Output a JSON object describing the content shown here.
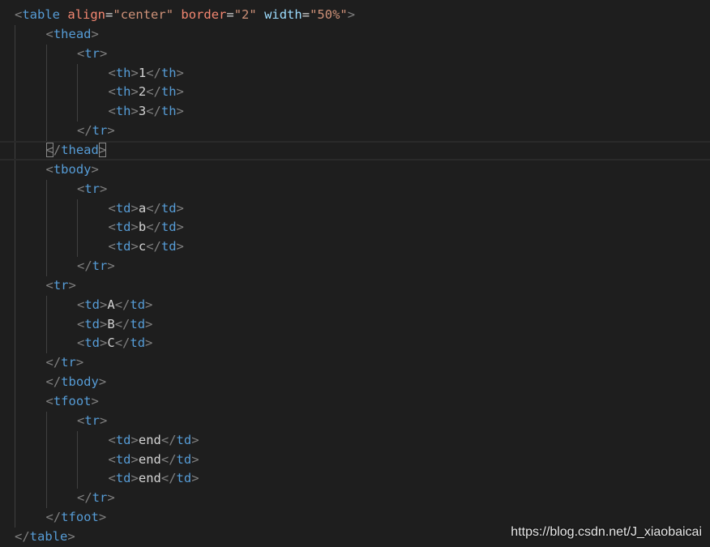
{
  "editor": {
    "lines": [
      {
        "indent": 0,
        "tokens": [
          [
            "b",
            "<"
          ],
          [
            "t",
            "table"
          ],
          [
            "x",
            " "
          ],
          [
            "ar",
            "align"
          ],
          [
            "e",
            "="
          ],
          [
            "s",
            "\"center\""
          ],
          [
            "x",
            " "
          ],
          [
            "ar",
            "border"
          ],
          [
            "e",
            "="
          ],
          [
            "s",
            "\"2\""
          ],
          [
            "x",
            " "
          ],
          [
            "a",
            "width"
          ],
          [
            "e",
            "="
          ],
          [
            "s",
            "\"50%\""
          ],
          [
            "b",
            ">"
          ]
        ]
      },
      {
        "indent": 1,
        "tokens": [
          [
            "b",
            "<"
          ],
          [
            "t",
            "thead"
          ],
          [
            "b",
            ">"
          ]
        ]
      },
      {
        "indent": 2,
        "tokens": [
          [
            "b",
            "<"
          ],
          [
            "t",
            "tr"
          ],
          [
            "b",
            ">"
          ]
        ]
      },
      {
        "indent": 3,
        "tokens": [
          [
            "b",
            "<"
          ],
          [
            "t",
            "th"
          ],
          [
            "b",
            ">"
          ],
          [
            "x",
            "1"
          ],
          [
            "b",
            "</"
          ],
          [
            "t",
            "th"
          ],
          [
            "b",
            ">"
          ]
        ]
      },
      {
        "indent": 3,
        "tokens": [
          [
            "b",
            "<"
          ],
          [
            "t",
            "th"
          ],
          [
            "b",
            ">"
          ],
          [
            "x",
            "2"
          ],
          [
            "b",
            "</"
          ],
          [
            "t",
            "th"
          ],
          [
            "b",
            ">"
          ]
        ]
      },
      {
        "indent": 3,
        "tokens": [
          [
            "b",
            "<"
          ],
          [
            "t",
            "th"
          ],
          [
            "b",
            ">"
          ],
          [
            "x",
            "3"
          ],
          [
            "b",
            "</"
          ],
          [
            "t",
            "th"
          ],
          [
            "b",
            ">"
          ]
        ]
      },
      {
        "indent": 2,
        "tokens": [
          [
            "b",
            "</"
          ],
          [
            "t",
            "tr"
          ],
          [
            "b",
            ">"
          ]
        ]
      },
      {
        "indent": 1,
        "current": true,
        "tokens": [
          [
            "bm",
            "<"
          ],
          [
            "b",
            "/"
          ],
          [
            "t",
            "thead"
          ],
          [
            "bm",
            ">"
          ]
        ]
      },
      {
        "indent": 1,
        "tokens": [
          [
            "b",
            "<"
          ],
          [
            "t",
            "tbody"
          ],
          [
            "b",
            ">"
          ]
        ]
      },
      {
        "indent": 2,
        "tokens": [
          [
            "b",
            "<"
          ],
          [
            "t",
            "tr"
          ],
          [
            "b",
            ">"
          ]
        ]
      },
      {
        "indent": 3,
        "tokens": [
          [
            "b",
            "<"
          ],
          [
            "t",
            "td"
          ],
          [
            "b",
            ">"
          ],
          [
            "x",
            "a"
          ],
          [
            "b",
            "</"
          ],
          [
            "t",
            "td"
          ],
          [
            "b",
            ">"
          ]
        ]
      },
      {
        "indent": 3,
        "tokens": [
          [
            "b",
            "<"
          ],
          [
            "t",
            "td"
          ],
          [
            "b",
            ">"
          ],
          [
            "x",
            "b"
          ],
          [
            "b",
            "</"
          ],
          [
            "t",
            "td"
          ],
          [
            "b",
            ">"
          ]
        ]
      },
      {
        "indent": 3,
        "tokens": [
          [
            "b",
            "<"
          ],
          [
            "t",
            "td"
          ],
          [
            "b",
            ">"
          ],
          [
            "x",
            "c"
          ],
          [
            "b",
            "</"
          ],
          [
            "t",
            "td"
          ],
          [
            "b",
            ">"
          ]
        ]
      },
      {
        "indent": 2,
        "tokens": [
          [
            "b",
            "</"
          ],
          [
            "t",
            "tr"
          ],
          [
            "b",
            ">"
          ]
        ]
      },
      {
        "indent": 1,
        "tokens": [
          [
            "b",
            "<"
          ],
          [
            "t",
            "tr"
          ],
          [
            "b",
            ">"
          ]
        ]
      },
      {
        "indent": 2,
        "tokens": [
          [
            "b",
            "<"
          ],
          [
            "t",
            "td"
          ],
          [
            "b",
            ">"
          ],
          [
            "x",
            "A"
          ],
          [
            "b",
            "</"
          ],
          [
            "t",
            "td"
          ],
          [
            "b",
            ">"
          ]
        ]
      },
      {
        "indent": 2,
        "tokens": [
          [
            "b",
            "<"
          ],
          [
            "t",
            "td"
          ],
          [
            "b",
            ">"
          ],
          [
            "x",
            "B"
          ],
          [
            "b",
            "</"
          ],
          [
            "t",
            "td"
          ],
          [
            "b",
            ">"
          ]
        ]
      },
      {
        "indent": 2,
        "tokens": [
          [
            "b",
            "<"
          ],
          [
            "t",
            "td"
          ],
          [
            "b",
            ">"
          ],
          [
            "x",
            "C"
          ],
          [
            "b",
            "</"
          ],
          [
            "t",
            "td"
          ],
          [
            "b",
            ">"
          ]
        ]
      },
      {
        "indent": 1,
        "tokens": [
          [
            "b",
            "</"
          ],
          [
            "t",
            "tr"
          ],
          [
            "b",
            ">"
          ]
        ]
      },
      {
        "indent": 1,
        "tokens": [
          [
            "b",
            "</"
          ],
          [
            "t",
            "tbody"
          ],
          [
            "b",
            ">"
          ]
        ]
      },
      {
        "indent": 1,
        "tokens": [
          [
            "b",
            "<"
          ],
          [
            "t",
            "tfoot"
          ],
          [
            "b",
            ">"
          ]
        ]
      },
      {
        "indent": 2,
        "tokens": [
          [
            "b",
            "<"
          ],
          [
            "t",
            "tr"
          ],
          [
            "b",
            ">"
          ]
        ]
      },
      {
        "indent": 3,
        "tokens": [
          [
            "b",
            "<"
          ],
          [
            "t",
            "td"
          ],
          [
            "b",
            ">"
          ],
          [
            "x",
            "end"
          ],
          [
            "b",
            "</"
          ],
          [
            "t",
            "td"
          ],
          [
            "b",
            ">"
          ]
        ]
      },
      {
        "indent": 3,
        "tokens": [
          [
            "b",
            "<"
          ],
          [
            "t",
            "td"
          ],
          [
            "b",
            ">"
          ],
          [
            "x",
            "end"
          ],
          [
            "b",
            "</"
          ],
          [
            "t",
            "td"
          ],
          [
            "b",
            ">"
          ]
        ]
      },
      {
        "indent": 3,
        "tokens": [
          [
            "b",
            "<"
          ],
          [
            "t",
            "td"
          ],
          [
            "b",
            ">"
          ],
          [
            "x",
            "end"
          ],
          [
            "b",
            "</"
          ],
          [
            "t",
            "td"
          ],
          [
            "b",
            ">"
          ]
        ]
      },
      {
        "indent": 2,
        "tokens": [
          [
            "b",
            "</"
          ],
          [
            "t",
            "tr"
          ],
          [
            "b",
            ">"
          ]
        ]
      },
      {
        "indent": 1,
        "tokens": [
          [
            "b",
            "</"
          ],
          [
            "t",
            "tfoot"
          ],
          [
            "b",
            ">"
          ]
        ]
      },
      {
        "indent": 0,
        "tokens": [
          [
            "b",
            "</"
          ],
          [
            "t",
            "table"
          ],
          [
            "b",
            ">"
          ]
        ]
      }
    ]
  },
  "colors": {
    "background": "#1e1e1e",
    "bracket": "#808080",
    "tag": "#569cd6",
    "attribute": "#9cdcfe",
    "attribute_alt": "#f48771",
    "string": "#ce9178",
    "text": "#d4d4d4"
  },
  "watermark": {
    "text": "https://blog.csdn.net/J_xiaobaicai"
  }
}
